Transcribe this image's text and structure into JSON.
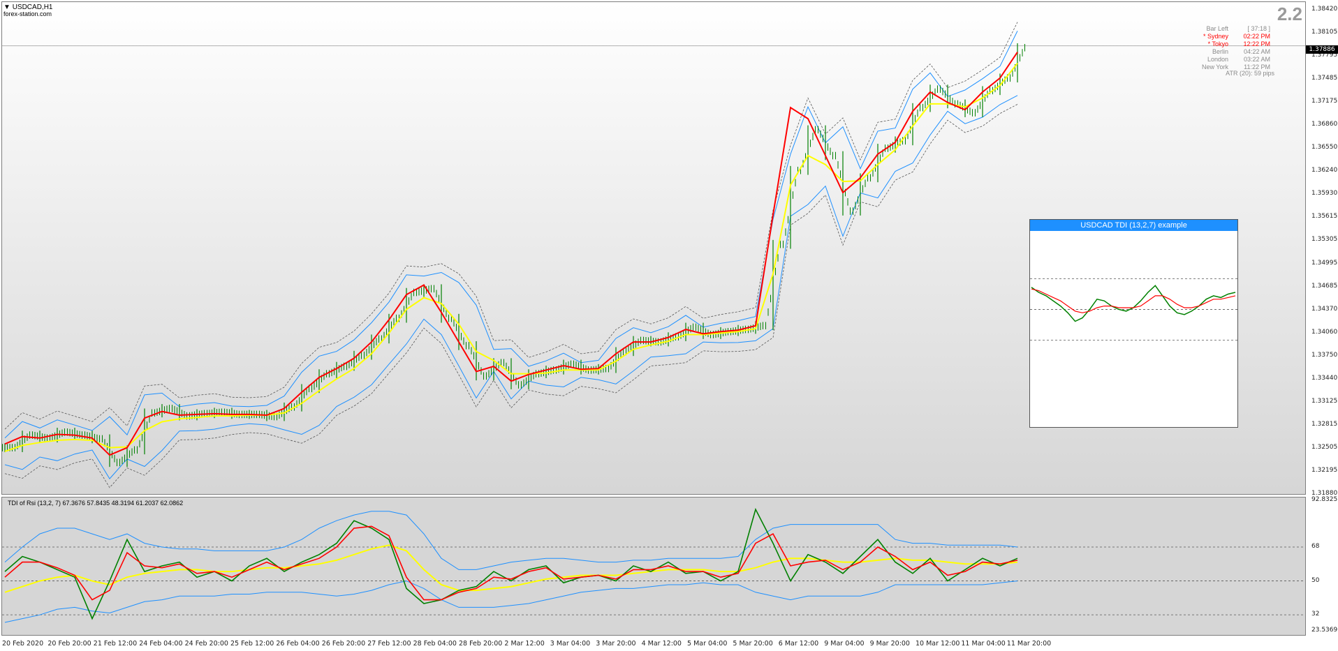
{
  "window": {
    "symbol": "USDCAD,H1",
    "watermark": "forex-station.com"
  },
  "spread_value": "2.2",
  "sessions": [
    {
      "name": "Bar Left",
      "time": "[ 37:18 ]",
      "color": "#8a8a8a"
    },
    {
      "name": "* Sydney",
      "time": "02:22 PM",
      "color": "#ff0000"
    },
    {
      "name": "* Tokyo",
      "time": "12:22 PM",
      "color": "#ff0000"
    },
    {
      "name": "Berlin",
      "time": "04:22 AM",
      "color": "#8a8a8a"
    },
    {
      "name": "London",
      "time": "03:22 AM",
      "color": "#8a8a8a"
    },
    {
      "name": "New York",
      "time": "11:22 PM",
      "color": "#8a8a8a"
    }
  ],
  "atr_text": "ATR (20): 59 pips",
  "current_price": "1.37886",
  "price_axis_labels": [
    "1.38420",
    "1.38105",
    "1.37795",
    "1.37485",
    "1.37175",
    "1.36860",
    "1.36550",
    "1.36240",
    "1.35930",
    "1.35615",
    "1.35305",
    "1.34995",
    "1.34685",
    "1.34370",
    "1.34060",
    "1.33750",
    "1.33440",
    "1.33125",
    "1.32815",
    "1.32505",
    "1.32195",
    "1.31880"
  ],
  "tdi_axis_labels": [
    "92.8325",
    "68",
    "50",
    "32",
    "23.5369"
  ],
  "tdi_label": "TDI of Rsi  (13,2, 7) 67.3676 57.8435 48.3194 61.2037 62.0862",
  "time_labels": [
    "20 Feb 2020",
    "20 Feb 20:00",
    "21 Feb 12:00",
    "24 Feb 04:00",
    "24 Feb 20:00",
    "25 Feb 12:00",
    "26 Feb 04:00",
    "26 Feb 20:00",
    "27 Feb 12:00",
    "28 Feb 04:00",
    "28 Feb 20:00",
    "2 Mar 12:00",
    "3 Mar 04:00",
    "3 Mar 20:00",
    "4 Mar 12:00",
    "5 Mar 04:00",
    "5 Mar 20:00",
    "6 Mar 12:00",
    "9 Mar 04:00",
    "9 Mar 20:00",
    "10 Mar 12:00",
    "11 Mar 04:00",
    "11 Mar 20:00"
  ],
  "inset_title": "USDCAD TDI (13,2,7) example",
  "colors": {
    "bull": "#008000",
    "bear": "#008000",
    "fast": "#ff0000",
    "slow": "#ffff00",
    "band": "#1e90ff",
    "env": "#555555",
    "accent": "#1e90ff"
  },
  "chart_data": {
    "type": "line",
    "y_range": [
      1.3188,
      1.3842
    ],
    "close": [
      1.3245,
      1.3262,
      1.3258,
      1.3266,
      1.3262,
      1.3257,
      1.3225,
      1.3242,
      1.3292,
      1.3298,
      1.3288,
      1.3291,
      1.3293,
      1.329,
      1.329,
      1.3287,
      1.33,
      1.3325,
      1.3345,
      1.3355,
      1.337,
      1.3392,
      1.342,
      1.3455,
      1.346,
      1.342,
      1.3383,
      1.3342,
      1.336,
      1.333,
      1.3345,
      1.335,
      1.3358,
      1.335,
      1.3352,
      1.3375,
      1.339,
      1.3388,
      1.3395,
      1.3408,
      1.3398,
      1.3402,
      1.3405,
      1.341,
      1.352,
      1.362,
      1.3675,
      1.364,
      1.3565,
      1.361,
      1.365,
      1.366,
      1.3705,
      1.373,
      1.371,
      1.3698,
      1.3728,
      1.3745,
      1.3786
    ],
    "fast_ma": [
      1.325,
      1.326,
      1.3258,
      1.3263,
      1.3262,
      1.3258,
      1.3235,
      1.3245,
      1.3285,
      1.3294,
      1.3289,
      1.329,
      1.3291,
      1.329,
      1.329,
      1.3289,
      1.3298,
      1.332,
      1.334,
      1.3352,
      1.3366,
      1.3388,
      1.3418,
      1.3452,
      1.3465,
      1.3428,
      1.3388,
      1.3348,
      1.3355,
      1.3335,
      1.3344,
      1.335,
      1.3356,
      1.3351,
      1.3352,
      1.3372,
      1.3388,
      1.3388,
      1.3394,
      1.3405,
      1.3399,
      1.3402,
      1.3404,
      1.341,
      1.356,
      1.3705,
      1.369,
      1.364,
      1.359,
      1.361,
      1.3642,
      1.3658,
      1.37,
      1.3726,
      1.3712,
      1.3702,
      1.3726,
      1.3745,
      1.378
    ],
    "slow_ma": [
      1.324,
      1.3248,
      1.3252,
      1.3255,
      1.3256,
      1.3255,
      1.3245,
      1.3246,
      1.3268,
      1.328,
      1.3284,
      1.3286,
      1.3288,
      1.3288,
      1.3289,
      1.3289,
      1.3292,
      1.3305,
      1.3322,
      1.3338,
      1.3352,
      1.3372,
      1.34,
      1.3432,
      1.3448,
      1.344,
      1.3412,
      1.3375,
      1.3363,
      1.3345,
      1.3345,
      1.3346,
      1.335,
      1.335,
      1.335,
      1.3362,
      1.3378,
      1.3384,
      1.3389,
      1.3398,
      1.3398,
      1.34,
      1.3402,
      1.3406,
      1.348,
      1.36,
      1.364,
      1.3628,
      1.3605,
      1.3606,
      1.3628,
      1.3648,
      1.368,
      1.371,
      1.371,
      1.3706,
      1.3718,
      1.3735,
      1.3765
    ],
    "tdi": {
      "y_range": [
        23.5369,
        92.8325
      ],
      "levels": [
        68,
        50,
        32
      ],
      "rsi": [
        55,
        63,
        60,
        56,
        52,
        30,
        50,
        72,
        55,
        58,
        60,
        52,
        55,
        50,
        58,
        62,
        55,
        60,
        64,
        70,
        82,
        78,
        72,
        46,
        38,
        40,
        45,
        47,
        55,
        50,
        56,
        58,
        49,
        52,
        53,
        50,
        58,
        55,
        60,
        54,
        55,
        50,
        55,
        88,
        70,
        50,
        64,
        60,
        54,
        63,
        72,
        60,
        54,
        62,
        50,
        56,
        62,
        58,
        62
      ],
      "fast": [
        52,
        60,
        60,
        57,
        53,
        40,
        45,
        65,
        58,
        57,
        59,
        54,
        55,
        52,
        56,
        60,
        56,
        59,
        62,
        68,
        78,
        79,
        74,
        52,
        40,
        40,
        44,
        46,
        52,
        51,
        55,
        57,
        51,
        52,
        53,
        51,
        56,
        56,
        58,
        55,
        55,
        52,
        54,
        70,
        75,
        58,
        60,
        61,
        56,
        60,
        68,
        63,
        56,
        60,
        53,
        55,
        60,
        59,
        61
      ],
      "slow": [
        44,
        47,
        50,
        52,
        53,
        50,
        48,
        52,
        54,
        55,
        56,
        56,
        55,
        55,
        56,
        57,
        57,
        58,
        59,
        61,
        64,
        67,
        69,
        66,
        56,
        48,
        45,
        45,
        46,
        47,
        49,
        51,
        52,
        53,
        53,
        53,
        54,
        55,
        56,
        56,
        56,
        55,
        55,
        57,
        60,
        62,
        62,
        61,
        60,
        60,
        61,
        62,
        61,
        61,
        60,
        59,
        59,
        59,
        60
      ],
      "upper": [
        60,
        68,
        75,
        78,
        78,
        75,
        72,
        75,
        70,
        68,
        67,
        67,
        66,
        66,
        66,
        66,
        68,
        72,
        78,
        82,
        85,
        87,
        87,
        85,
        75,
        62,
        56,
        56,
        58,
        60,
        61,
        62,
        62,
        61,
        60,
        60,
        61,
        61,
        62,
        62,
        62,
        62,
        63,
        72,
        78,
        80,
        80,
        80,
        80,
        80,
        80,
        72,
        70,
        70,
        69,
        69,
        69,
        69,
        68
      ],
      "lower": [
        28,
        30,
        32,
        35,
        36,
        34,
        33,
        36,
        39,
        40,
        42,
        42,
        42,
        43,
        43,
        44,
        44,
        44,
        43,
        42,
        43,
        45,
        48,
        50,
        46,
        40,
        36,
        36,
        36,
        37,
        38,
        40,
        42,
        44,
        45,
        46,
        46,
        47,
        48,
        48,
        49,
        48,
        48,
        44,
        42,
        40,
        42,
        42,
        42,
        42,
        44,
        48,
        48,
        48,
        48,
        48,
        48,
        49,
        50
      ]
    },
    "inset_series": {
      "fast": [
        63,
        60,
        58,
        55,
        52,
        48,
        43,
        45,
        50,
        56,
        55,
        52,
        50,
        49,
        51,
        55,
        60,
        64,
        58,
        52,
        48,
        47,
        49,
        52,
        56,
        58,
        57,
        59,
        60
      ],
      "slow": [
        62,
        61,
        59,
        57,
        55,
        52,
        49,
        48,
        49,
        51,
        52,
        52,
        51,
        51,
        51,
        52,
        55,
        58,
        58,
        56,
        53,
        51,
        51,
        52,
        54,
        56,
        56,
        57,
        58
      ],
      "levels": [
        68,
        50,
        32
      ]
    }
  }
}
